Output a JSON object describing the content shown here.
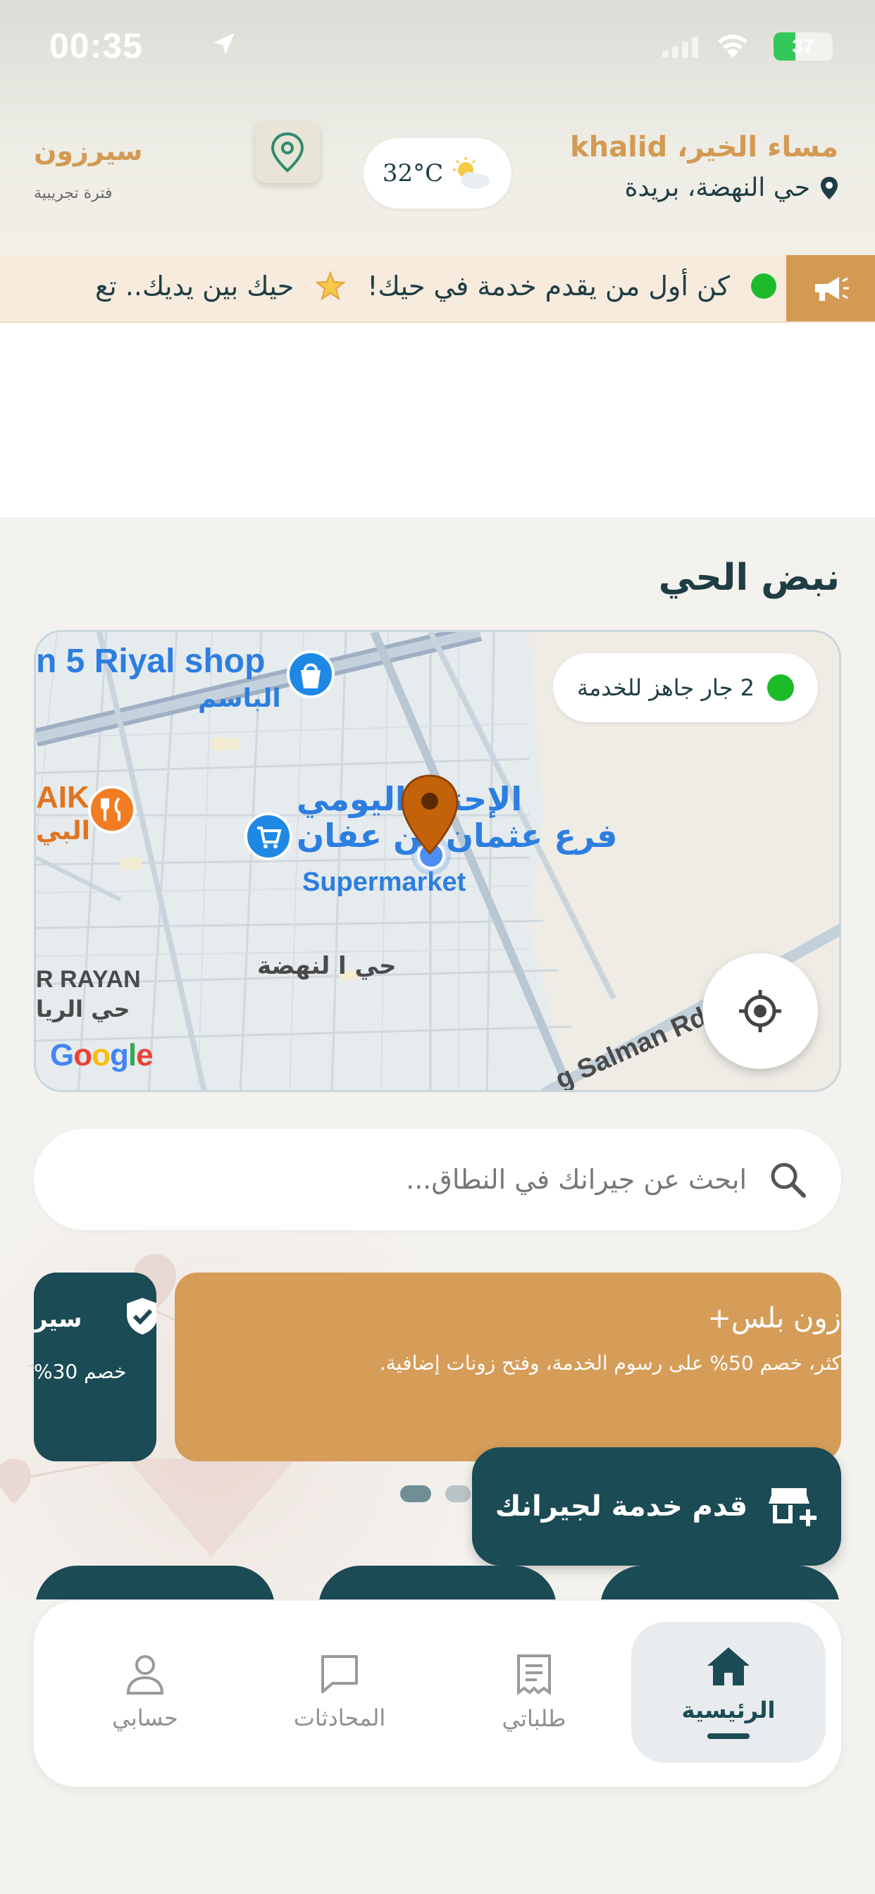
{
  "status_bar": {
    "time": "00:35",
    "battery": "37",
    "battery_level": 0.37
  },
  "header": {
    "brand_name": "سيرزون",
    "brand_subtitle": "فترة تجريبية",
    "greeting_prefix": "مساء الخير، ",
    "user_name": "khalid",
    "location": "حي النهضة، بريدة",
    "weather_temp": "32°C"
  },
  "ticker": {
    "messages": [
      "كن أول من يقدم خدمة في حيك!",
      "حيك بين يديك.. تع"
    ]
  },
  "section": {
    "title": "نبض الحي"
  },
  "map": {
    "ready_badge": "2 جار جاهز للخدمة",
    "labels": {
      "shop": "n 5 Riyal shop",
      "shop_ar": "الباسم",
      "market_ar1": "الإحتي اليومي",
      "market_ar2": "فرع عثمان بن عفان",
      "market_en": "Supermarket",
      "district_ar": "حي ا لنهضة",
      "rayan_en": "R RAYAN",
      "rayan_ar": "حي الريا",
      "restaurant_en": "AIK",
      "restaurant_ar": "البي",
      "road": "g Salman Rd",
      "google": "Google"
    }
  },
  "search": {
    "placeholder": "ابحث عن جيرانك في النطاق..."
  },
  "promos": {
    "main": {
      "title": "زون بلس+",
      "description": "كثر، خصم 50% على رسوم الخدمة، وفتح زونات إضافية."
    },
    "side": {
      "title": "سير",
      "description": "خصم 30%"
    }
  },
  "fab": {
    "label": "قدم خدمة لجيرانك"
  },
  "nav": {
    "items": [
      {
        "label": "الرئيسية",
        "icon": "home-icon",
        "active": true
      },
      {
        "label": "طلباتي",
        "icon": "orders-icon",
        "active": false
      },
      {
        "label": "المحادثات",
        "icon": "chat-icon",
        "active": false
      },
      {
        "label": "حسابي",
        "icon": "person-icon",
        "active": false
      }
    ]
  },
  "colors": {
    "primary": "#1b4b55",
    "accent": "#d49a53",
    "online": "#1dbb2a"
  }
}
